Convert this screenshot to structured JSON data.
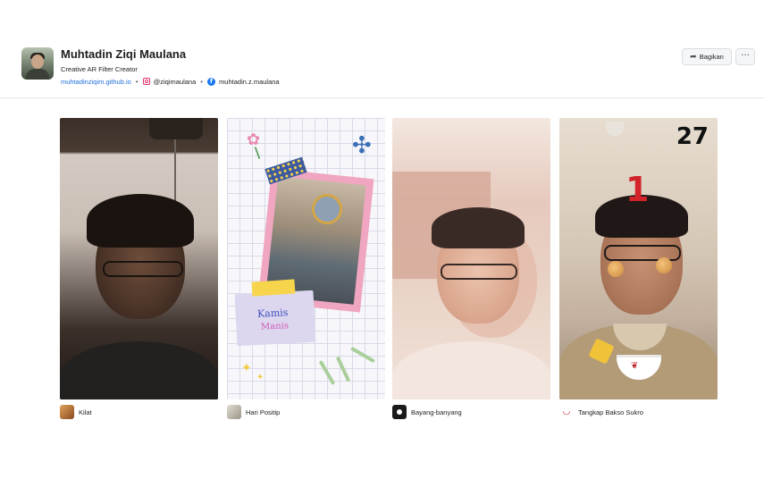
{
  "profile": {
    "name": "Muhtadin Ziqi Maulana",
    "tagline": "Creative AR Filter Creator",
    "website": "muhtadinziqim.github.io",
    "instagram": "@ziqimaulana",
    "facebook": "muhtadin.z.maulana"
  },
  "actions": {
    "share_label": "Bagikan",
    "share_icon": "share-icon",
    "more_label": "···"
  },
  "filters": [
    {
      "name": "Kilat",
      "thumb_color": "#b86a3a"
    },
    {
      "name": "Hari Positip",
      "thumb_color": "#c7c1b6"
    },
    {
      "name": "Bayang-banyang",
      "thumb_color": "#1a1a1a"
    },
    {
      "name": "Tangkap Bakso Sukro",
      "thumb_color": "#ffffff"
    }
  ],
  "card2": {
    "note_line1": "Kamis",
    "note_line2": "Manis"
  },
  "card4": {
    "score": "27",
    "countdown": "1"
  },
  "colors": {
    "link": "#216fdb",
    "instagram": "#e1306c",
    "facebook": "#1877f2"
  }
}
